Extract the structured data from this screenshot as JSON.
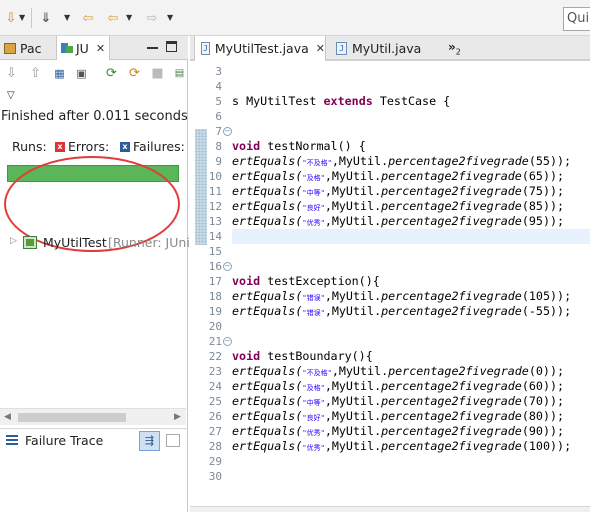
{
  "toolbar": {
    "quick_access": "Quic"
  },
  "left_panel": {
    "tabs": [
      {
        "label": "Pac",
        "icon": "package-explorer-icon"
      },
      {
        "label": "JU",
        "icon": "junit-icon",
        "active": true
      }
    ],
    "status": "Finished after 0.011 seconds",
    "runs_label": "Runs:",
    "errors_label": "Errors:",
    "failures_label": "Failures:",
    "progress": 1.0,
    "progress_color": "#5bb65a",
    "annotation_color": "#e23b3b",
    "tree": {
      "name": "MyUtilTest",
      "runner": "[Runner: JUni"
    },
    "failure_trace_label": "Failure Trace"
  },
  "editor": {
    "tabs": [
      {
        "label": "MyUtilTest.java",
        "active": true
      },
      {
        "label": "MyUtil.java",
        "active": false
      }
    ],
    "overflow_count": "2",
    "lines": [
      {
        "n": "3"
      },
      {
        "n": "4"
      },
      {
        "n": "5",
        "code": "s MyUtilTest extends TestCase {"
      },
      {
        "n": "6"
      },
      {
        "n": "7",
        "fold": true
      },
      {
        "n": "8",
        "code": "void testNormal() {"
      },
      {
        "n": "9",
        "call": "ertEquals(",
        "str": "\"不及格\"",
        "rest": ",MyUtil.",
        "method": "percentage2fivegrade",
        "args": "(55));"
      },
      {
        "n": "10",
        "call": "ertEquals(",
        "str": "\"及格\"",
        "rest": ",MyUtil.",
        "method": "percentage2fivegrade",
        "args": "(65));"
      },
      {
        "n": "11",
        "call": "ertEquals(",
        "str": "\"中等\"",
        "rest": ",MyUtil.",
        "method": "percentage2fivegrade",
        "args": "(75));"
      },
      {
        "n": "12",
        "call": "ertEquals(",
        "str": "\"良好\"",
        "rest": ",MyUtil.",
        "method": "percentage2fivegrade",
        "args": "(85));"
      },
      {
        "n": "13",
        "call": "ertEquals(",
        "str": "\"优秀\"",
        "rest": ",MyUtil.",
        "method": "percentage2fivegrade",
        "args": "(95));"
      },
      {
        "n": "14"
      },
      {
        "n": "15"
      },
      {
        "n": "16",
        "fold": true
      },
      {
        "n": "17",
        "code": "void testException(){"
      },
      {
        "n": "18",
        "call": "ertEquals(",
        "str": "\"错误\"",
        "rest": ",MyUtil.",
        "method": "percentage2fivegrade",
        "args": "(105));"
      },
      {
        "n": "19",
        "call": "ertEquals(",
        "str": "\"错误\"",
        "rest": ",MyUtil.",
        "method": "percentage2fivegrade",
        "args": "(-55));"
      },
      {
        "n": "20"
      },
      {
        "n": "21",
        "fold": true
      },
      {
        "n": "22",
        "code": "void testBoundary(){"
      },
      {
        "n": "23",
        "call": "ertEquals(",
        "str": "\"不及格\"",
        "rest": ",MyUtil.",
        "method": "percentage2fivegrade",
        "args": "(0));"
      },
      {
        "n": "24",
        "call": "ertEquals(",
        "str": "\"及格\"",
        "rest": ",MyUtil.",
        "method": "percentage2fivegrade",
        "args": "(60));"
      },
      {
        "n": "25",
        "call": "ertEquals(",
        "str": "\"中等\"",
        "rest": ",MyUtil.",
        "method": "percentage2fivegrade",
        "args": "(70));"
      },
      {
        "n": "26",
        "call": "ertEquals(",
        "str": "\"良好\"",
        "rest": ",MyUtil.",
        "method": "percentage2fivegrade",
        "args": "(80));"
      },
      {
        "n": "27",
        "call": "ertEquals(",
        "str": "\"优秀\"",
        "rest": ",MyUtil.",
        "method": "percentage2fivegrade",
        "args": "(90));"
      },
      {
        "n": "28",
        "call": "ertEquals(",
        "str": "\"优秀\"",
        "rest": ",MyUtil.",
        "method": "percentage2fivegrade",
        "args": "(100));"
      },
      {
        "n": "29"
      },
      {
        "n": "30"
      }
    ]
  }
}
